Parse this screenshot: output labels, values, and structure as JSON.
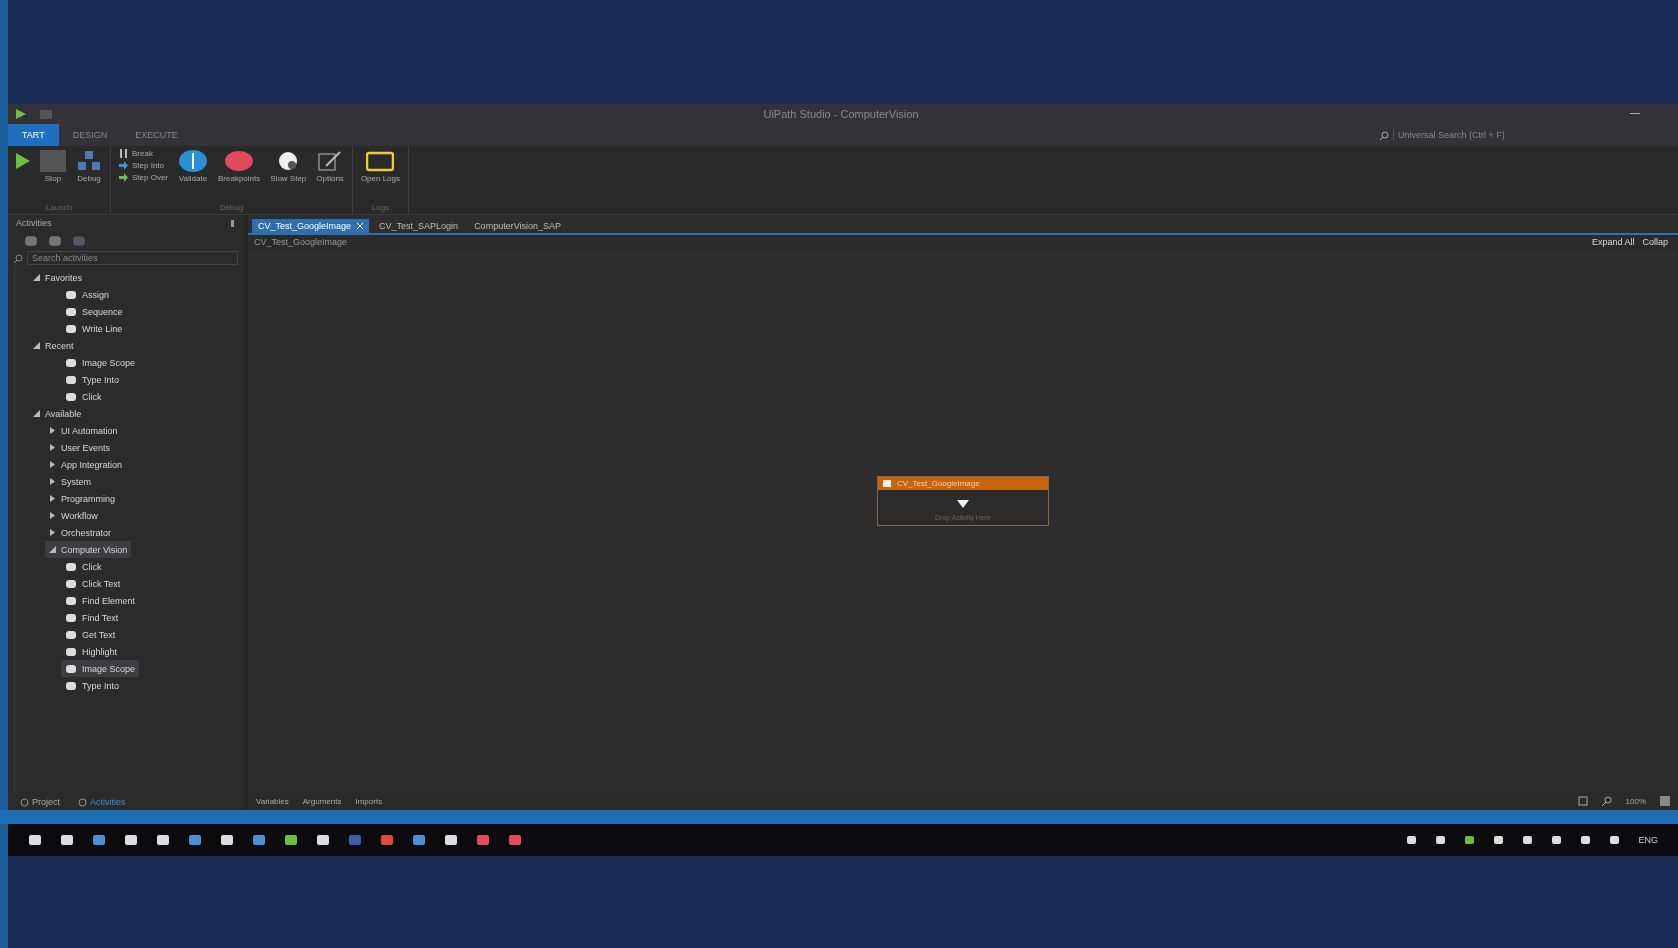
{
  "window": {
    "title": "UiPath Studio - ComputerVision",
    "search": {
      "placeholder": "Universal Search (Ctrl + F)"
    }
  },
  "ribbon_tabs": [
    {
      "label": "TART",
      "selected": true
    },
    {
      "label": "DESIGN",
      "selected": false
    },
    {
      "label": "EXECUTE",
      "selected": false
    }
  ],
  "ribbon_groups": [
    {
      "label": "Launch",
      "buttons": [
        {
          "kind": "run"
        },
        {
          "kind": "stop",
          "label": "Stop"
        },
        {
          "kind": "debug",
          "label": "Debug"
        }
      ]
    },
    {
      "label": "Debug",
      "small": [
        {
          "kind": "break",
          "label": "Break"
        },
        {
          "kind": "into",
          "label": "Step Into"
        },
        {
          "kind": "over",
          "label": "Step Over"
        }
      ],
      "buttons": [
        {
          "kind": "validate",
          "label": "Validate"
        },
        {
          "kind": "breakpoints",
          "label": "Breakpoints"
        },
        {
          "kind": "slow",
          "label": "Slow Step"
        },
        {
          "kind": "options",
          "label": "Options"
        }
      ]
    },
    {
      "label": "Logs",
      "buttons": [
        {
          "kind": "logs",
          "label": "Open Logs"
        }
      ]
    }
  ],
  "activities_panel": {
    "title": "Activities",
    "search": {
      "placeholder": "Search activities"
    },
    "tree": [
      {
        "label": "Favorites",
        "expanded": true,
        "selected": false,
        "children": [
          {
            "label": "Assign",
            "selected": false
          },
          {
            "label": "Sequence",
            "selected": false
          },
          {
            "label": "Write Line",
            "selected": false
          }
        ]
      },
      {
        "label": "Recent",
        "expanded": true,
        "selected": false,
        "children": [
          {
            "label": "Image Scope",
            "selected": false
          },
          {
            "label": "Type Into",
            "selected": false
          },
          {
            "label": "Click",
            "selected": false
          }
        ]
      },
      {
        "label": "Available",
        "expanded": true,
        "selected": false,
        "children": [
          {
            "label": "UI Automation",
            "expanded": false,
            "selected": false
          },
          {
            "label": "User Events",
            "expanded": false,
            "selected": false
          },
          {
            "label": "App Integration",
            "expanded": false,
            "selected": false
          },
          {
            "label": "System",
            "expanded": false,
            "selected": false
          },
          {
            "label": "Programming",
            "expanded": false,
            "selected": false
          },
          {
            "label": "Workflow",
            "expanded": false,
            "selected": false
          },
          {
            "label": "Orchestrator",
            "expanded": false,
            "selected": false
          },
          {
            "label": "Computer Vision",
            "expanded": true,
            "selected": true,
            "children": [
              {
                "label": "Click",
                "selected": false
              },
              {
                "label": "Click Text",
                "selected": false
              },
              {
                "label": "Find Element",
                "selected": false
              },
              {
                "label": "Find Text",
                "selected": false
              },
              {
                "label": "Get Text",
                "selected": false
              },
              {
                "label": "Highlight",
                "selected": false
              },
              {
                "label": "Image Scope",
                "selected": true
              },
              {
                "label": "Type Into",
                "selected": false
              }
            ]
          }
        ]
      }
    ],
    "bottom_tabs": [
      {
        "label": "Project",
        "selected": false
      },
      {
        "label": "Activities",
        "selected": true
      }
    ]
  },
  "document_tabs": [
    {
      "label": "CV_Test_GoogleImage",
      "selected": true
    },
    {
      "label": "CV_Test_SAPLogin",
      "selected": false
    },
    {
      "label": "ComputerVision_SAP",
      "selected": false
    }
  ],
  "designer": {
    "breadcrumb": "CV_Test_GoogleImage",
    "expand_all": "Expand All",
    "collapse": "Collap",
    "sequence": {
      "title": "CV_Test_GoogleImage",
      "hint": "Drop Activity Here"
    }
  },
  "designer_footer": {
    "tabs": [
      "Variables",
      "Arguments",
      "Imports"
    ],
    "zoom": "100%"
  },
  "taskbar": {
    "language": "ENG"
  }
}
